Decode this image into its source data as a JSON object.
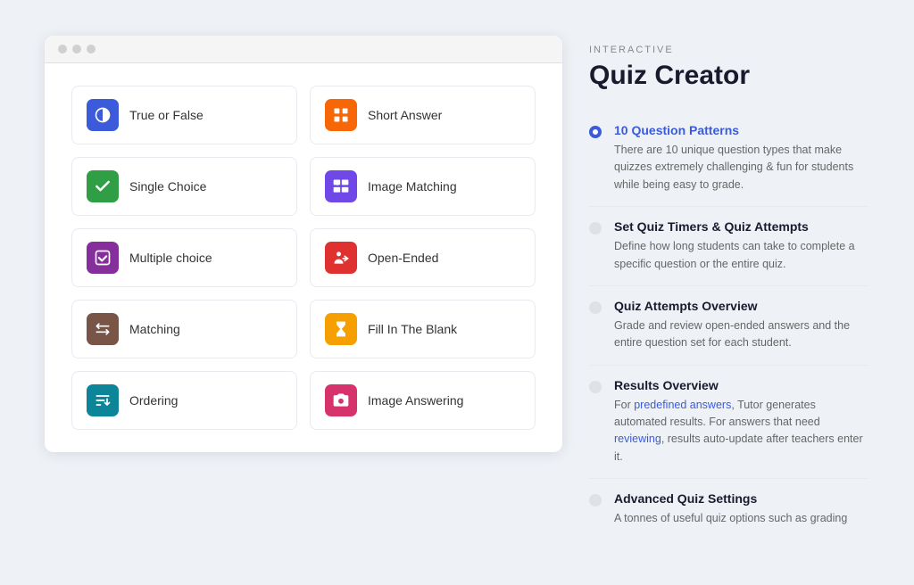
{
  "header": {
    "label": "INTERACTIVE",
    "title": "Quiz Creator"
  },
  "quiz_items": [
    {
      "id": "true-or-false",
      "label": "True or False",
      "icon_class": "icon-blue",
      "icon": "circle-half"
    },
    {
      "id": "short-answer",
      "label": "Short Answer",
      "icon_class": "icon-orange",
      "icon": "plus-grid"
    },
    {
      "id": "single-choice",
      "label": "Single Choice",
      "icon_class": "icon-green",
      "icon": "check"
    },
    {
      "id": "image-matching",
      "label": "Image Matching",
      "icon_class": "icon-indigo",
      "icon": "image-match"
    },
    {
      "id": "multiple-choice",
      "label": "Multiple choice",
      "icon_class": "icon-purple",
      "icon": "check-box"
    },
    {
      "id": "open-ended",
      "label": "Open-Ended",
      "icon_class": "icon-red-orange",
      "icon": "person-arrow"
    },
    {
      "id": "matching",
      "label": "Matching",
      "icon_class": "icon-brown",
      "icon": "arrows-lr"
    },
    {
      "id": "fill-in-blank",
      "label": "Fill In The Blank",
      "icon_class": "icon-yellow",
      "icon": "hourglass"
    },
    {
      "id": "ordering",
      "label": "Ordering",
      "icon_class": "icon-teal",
      "icon": "sort"
    },
    {
      "id": "image-answering",
      "label": "Image Answering",
      "icon_class": "icon-pink",
      "icon": "camera"
    }
  ],
  "features": [
    {
      "id": "question-patterns",
      "heading": "10 Question Patterns",
      "desc": "There are 10 unique question types that make quizzes extremely challenging & fun for students while being easy to grade.",
      "active": true,
      "highlight_words": []
    },
    {
      "id": "quiz-timers",
      "heading": "Set Quiz Timers & Quiz Attempts",
      "desc": "Define how long students can take to complete a specific question or the entire quiz.",
      "active": false,
      "highlight_words": []
    },
    {
      "id": "quiz-attempts-overview",
      "heading": "Quiz Attempts Overview",
      "desc": "Grade and review open-ended answers and the entire question set for each student.",
      "active": false,
      "highlight_words": []
    },
    {
      "id": "results-overview",
      "heading": "Results Overview",
      "desc_parts": [
        {
          "text": "For ",
          "highlight": false
        },
        {
          "text": "predefined answers",
          "highlight": true
        },
        {
          "text": ", Tutor generates automated results. For answers that need ",
          "highlight": false
        },
        {
          "text": "reviewing",
          "highlight": true
        },
        {
          "text": ", results auto-update after teachers enter it.",
          "highlight": false
        }
      ],
      "active": false
    },
    {
      "id": "advanced-quiz-settings",
      "heading": "Advanced Quiz Settings",
      "desc": "A tonnes of useful quiz options such as grading",
      "active": false
    }
  ]
}
